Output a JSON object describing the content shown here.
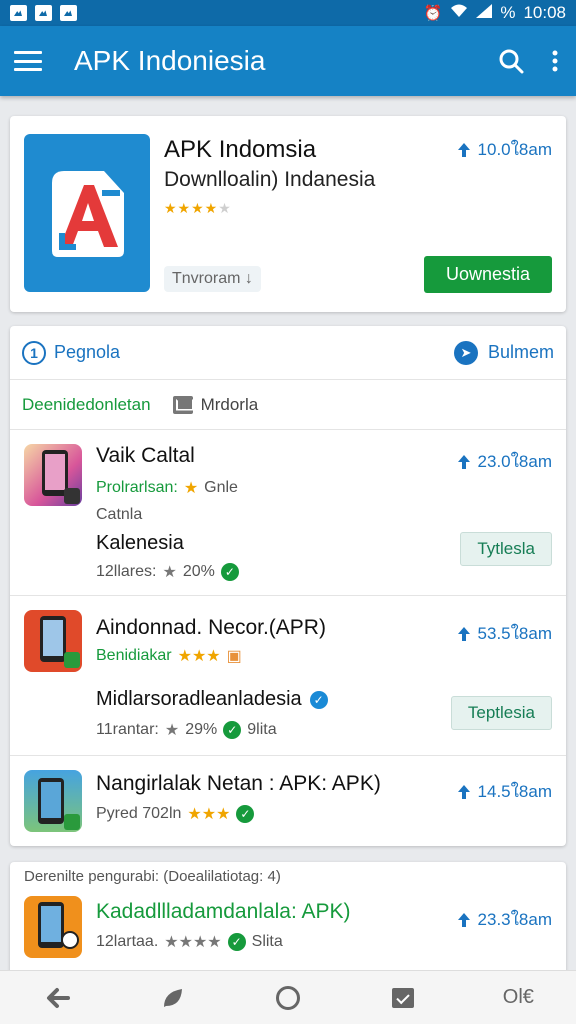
{
  "status_bar": {
    "time": "10:08",
    "battery": "%"
  },
  "app_bar": {
    "title": "APK Indoniesia"
  },
  "featured": {
    "title": "APK Indomsia",
    "subtitle": "Downlloalin) Indanesia",
    "size": "10.0ใ8am",
    "chip": "Tnvroram",
    "button": "Uownestia"
  },
  "list": {
    "tabs": {
      "left_number": "1",
      "left_label": "Pegnola",
      "right_label": "Bulmem"
    },
    "filters": {
      "green": "Deenidedonletan",
      "gray": "Mrdorla"
    },
    "apps": [
      {
        "name": "Vaik Caltal",
        "line1_green": "Prolrarlsan:",
        "line1_rest": "Gnle",
        "line2": "Catnla",
        "line3": "Kalenesia",
        "stats": "12llares:",
        "rating": "20%",
        "size": "23.0ใ8am",
        "button": "Tytlesla"
      },
      {
        "name": "Aindonnad. Necor.(APR)",
        "line1_green": "Benidiakar",
        "line3": "Midlarsoradleanladesia",
        "stats": "11rantar:",
        "rating": "29%",
        "extra": "9lita",
        "size": "53.5ใ8am",
        "button": "Teptlesia"
      },
      {
        "name": "Nangirlalak Netan : APK: APK)",
        "stats": "Pyred 702ln",
        "size": "14.5ใ8am"
      }
    ]
  },
  "bottom": {
    "caption": "Derenilte pengurabi: (Doealilatiotag: 4)",
    "app": {
      "name": "Kadadllladamdanlala: APK)",
      "stats": "12lartaa.",
      "extra": "Slita",
      "size": "23.3ใ8am"
    }
  },
  "nav": {
    "right_label": "Ol€"
  },
  "colors": {
    "primary": "#1582c5",
    "green": "#169a3c",
    "star": "#f0a500"
  }
}
